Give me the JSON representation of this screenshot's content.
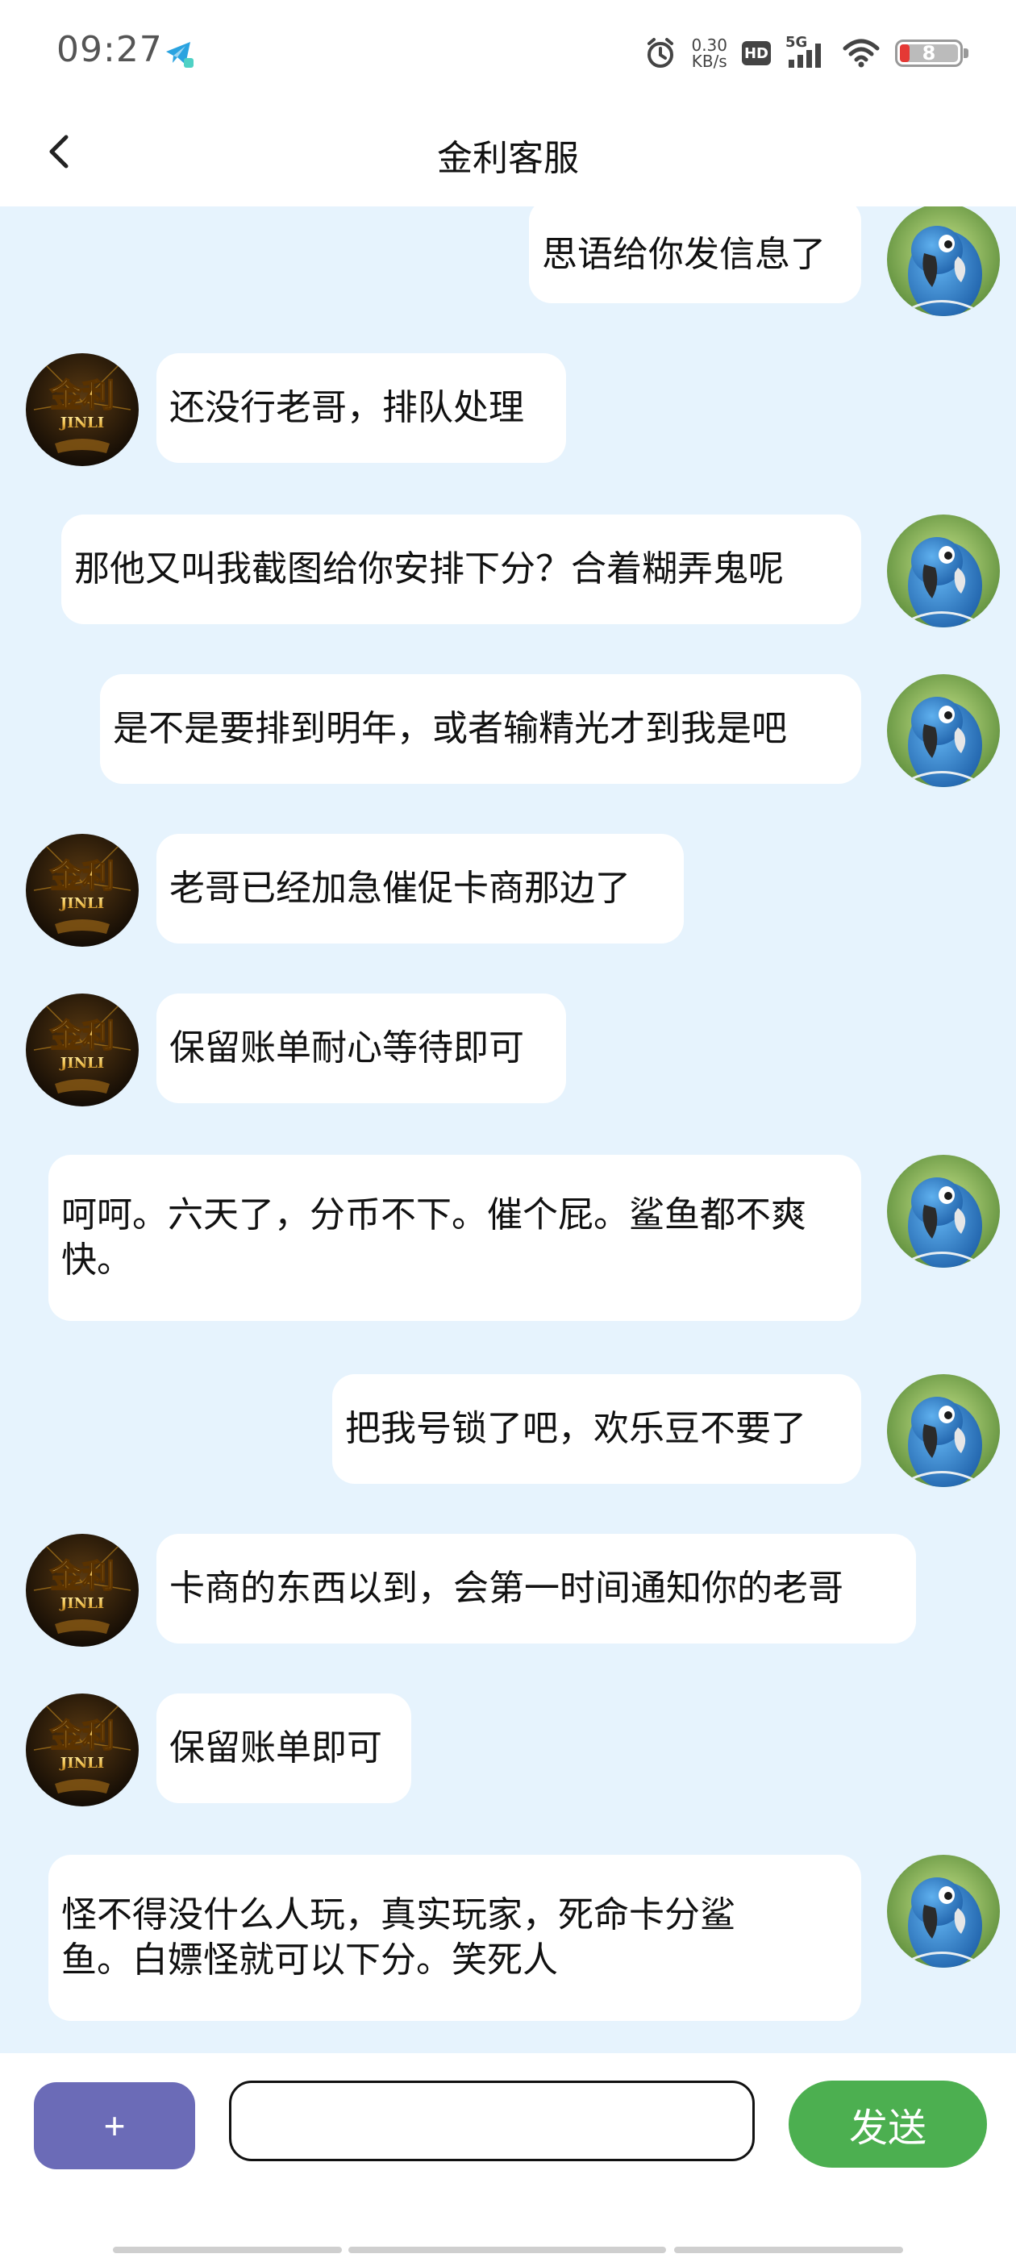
{
  "status_bar": {
    "time": "09:27",
    "net_speed_value": "0.30",
    "net_speed_unit": "KB/s",
    "hd_label": "HD",
    "network": "5G",
    "battery_level": "8",
    "icons": [
      "telegram-icon",
      "alarm-icon",
      "signal-icon",
      "wifi-icon",
      "battery-icon"
    ]
  },
  "header": {
    "back_icon": "chevron-left-icon",
    "title": "金利客服"
  },
  "messages": [
    {
      "sender": "user",
      "text": "思语给你发信息了"
    },
    {
      "sender": "agent",
      "text": "还没行老哥，排队处理"
    },
    {
      "sender": "user",
      "text": "那他又叫我截图给你安排下分？合着糊弄鬼呢"
    },
    {
      "sender": "user",
      "text": "是不是要排到明年，或者输精光才到我是吧"
    },
    {
      "sender": "agent",
      "text": "老哥已经加急催促卡商那边了"
    },
    {
      "sender": "agent",
      "text": "保留账单耐心等待即可"
    },
    {
      "sender": "user",
      "text": "呵呵。六天了，分币不下。催个屁。鲨鱼都不爽快。"
    },
    {
      "sender": "user",
      "text": "把我号锁了吧，欢乐豆不要了"
    },
    {
      "sender": "agent",
      "text": "卡商的东西以到，会第一时间通知你的老哥"
    },
    {
      "sender": "agent",
      "text": "保留账单即可"
    },
    {
      "sender": "user",
      "text": "怪不得没什么人玩，真实玩家，死命卡分鲨鱼。白嫖怪就可以下分。笑死人"
    }
  ],
  "agent_avatar_logo": {
    "top": "金利",
    "bottom": "JINLI"
  },
  "input_bar": {
    "plus_label": "+",
    "input_value": "",
    "send_label": "发送"
  },
  "colors": {
    "chat_background": "#e6f3fd",
    "plus_button": "#6b6bb7",
    "send_button": "#4caf50",
    "bubble": "#ffffff"
  }
}
